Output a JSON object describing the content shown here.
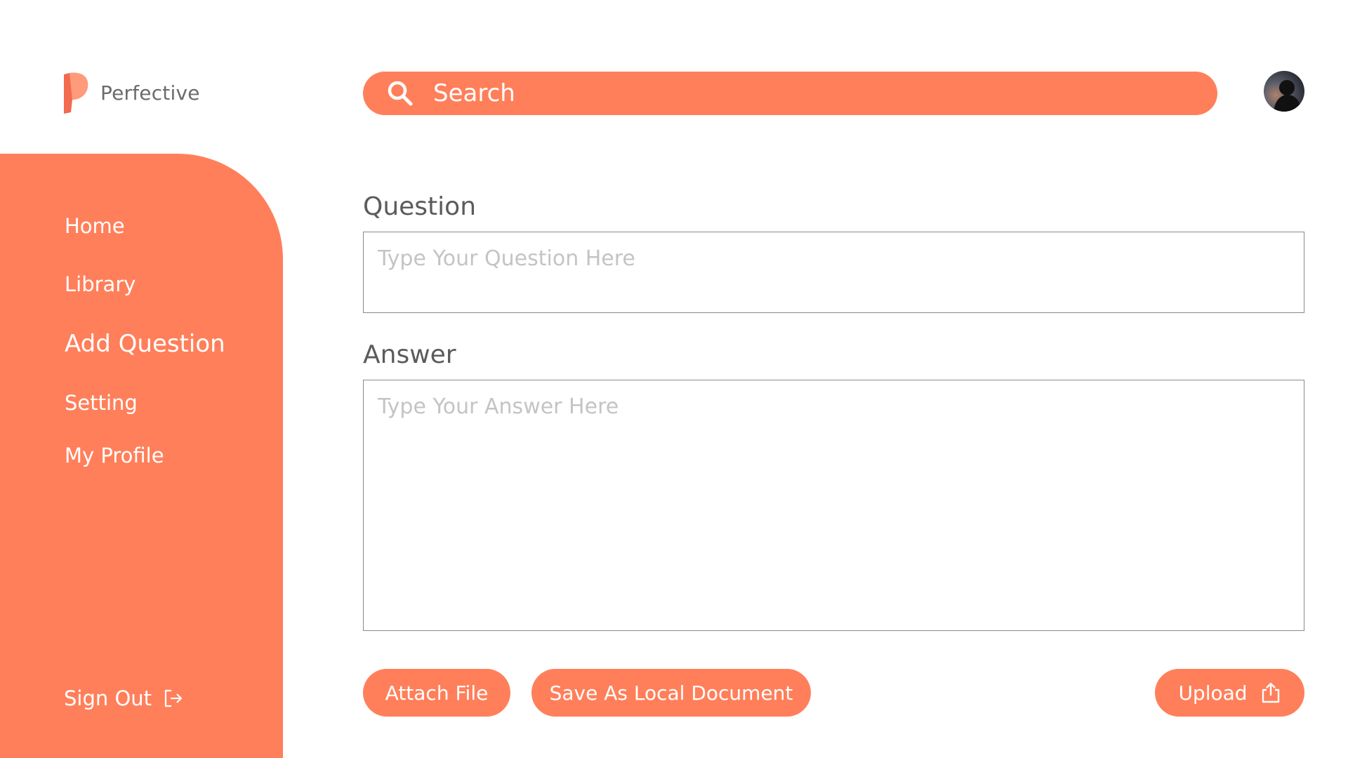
{
  "brand": {
    "name": "Perfective"
  },
  "search": {
    "placeholder": "Search"
  },
  "sidebar": {
    "items": [
      {
        "label": "Home"
      },
      {
        "label": "Library"
      },
      {
        "label": "Add Question"
      },
      {
        "label": "Setting"
      },
      {
        "label": "My Profile"
      }
    ],
    "active": "Add Question",
    "signout_label": "Sign Out"
  },
  "form": {
    "question_label": "Question",
    "question_placeholder": "Type Your Question Here",
    "answer_label": "Answer",
    "answer_placeholder": "Type Your Answer Here"
  },
  "actions": {
    "attach_label": "Attach File",
    "save_local_label": "Save As Local Document",
    "upload_label": "Upload"
  },
  "colors": {
    "accent": "#FF7F5A",
    "text_muted": "#6b6b6b",
    "placeholder": "#c4c4c4"
  },
  "icons": [
    "logo-mark",
    "search-icon",
    "sign-out-icon",
    "upload-icon",
    "avatar"
  ]
}
